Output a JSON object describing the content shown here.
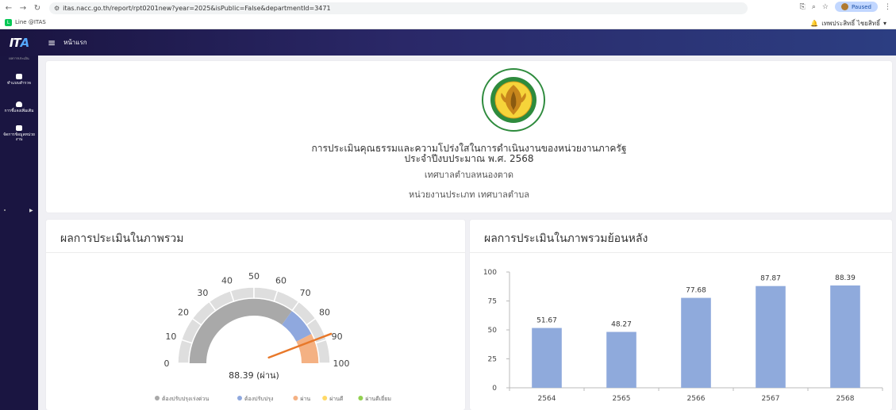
{
  "browser": {
    "url": "itas.nacc.go.th/report/rpt0201new?year=2025&isPublic=False&departmentId=3471",
    "profile_status": "Paused"
  },
  "bookmarks": [
    {
      "label": "Line @ITAS"
    }
  ],
  "user": {
    "name": "เทพประสิทธิ์ ไชยสิทธิ์"
  },
  "app": {
    "logo_main": "IT",
    "logo_accent": "A",
    "header_title": "หน้าแรก"
  },
  "sidebar": {
    "top_label": "ผลการประเมิน",
    "items": [
      {
        "label": "ทำแบบสำรวจ"
      },
      {
        "label": "การชี้แจงเพิ่มเติม"
      },
      {
        "label": "จัดการข้อมูลหน่วยงาน"
      }
    ]
  },
  "report": {
    "title_line1": "การประเมินคุณธรรมและความโปร่งใสในการดำเนินงานของหน่วยงานภาครัฐ",
    "title_line2": "ประจำปีงบประมาณ พ.ศ. 2568",
    "organization": "เทศบาลตำบลหนองตาด",
    "org_type": "หน่วยงานประเภท เทศบาลตำบล",
    "seal_text_top": "เทศบาลตำบลหนองตาด",
    "seal_text_bottom": "NONGTAD SUBDISTRICT MUNICIPALITY"
  },
  "overall_panel": {
    "title": "ผลการประเมินในภาพรวม",
    "gauge": {
      "score": 88.39,
      "score_label": "88.39 (ผ่าน)",
      "min": 0,
      "max": 100,
      "ticks": [
        "0",
        "10",
        "20",
        "30",
        "40",
        "50",
        "60",
        "70",
        "80",
        "90",
        "100"
      ],
      "bands": [
        {
          "from": 0,
          "to": 70,
          "color": "#a9a9a9"
        },
        {
          "from": 70,
          "to": 85,
          "color": "#8fa8de"
        },
        {
          "from": 85,
          "to": 100,
          "color": "#f4b183"
        }
      ],
      "needle_color": "#e8782a"
    },
    "legend": [
      {
        "label": "ต้องปรับปรุงเร่งด่วน",
        "color": "#a9a9a9"
      },
      {
        "label": "ต้องปรับปรุง",
        "color": "#8fa8de"
      },
      {
        "label": "ผ่าน",
        "color": "#f4b183"
      },
      {
        "label": "ผ่านดี",
        "color": "#ffd966"
      },
      {
        "label": "ผ่านดีเยี่ยม",
        "color": "#92d050"
      }
    ]
  },
  "history_panel": {
    "title": "ผลการประเมินในภาพรวมย้อนหลัง"
  },
  "chart_data": {
    "type": "bar",
    "categories": [
      "2564",
      "2565",
      "2566",
      "2567",
      "2568"
    ],
    "values": [
      51.67,
      48.27,
      77.68,
      87.87,
      88.39
    ],
    "data_labels": [
      "51.67",
      "48.27",
      "77.68",
      "87.87",
      "88.39"
    ],
    "yticks": [
      "0",
      "25",
      "50",
      "75",
      "100"
    ],
    "ylim": [
      0,
      100
    ],
    "bar_color": "#8faadc",
    "grid": false,
    "title": "ผลการประเมินในภาพรวมย้อนหลัง",
    "xlabel": "",
    "ylabel": ""
  }
}
